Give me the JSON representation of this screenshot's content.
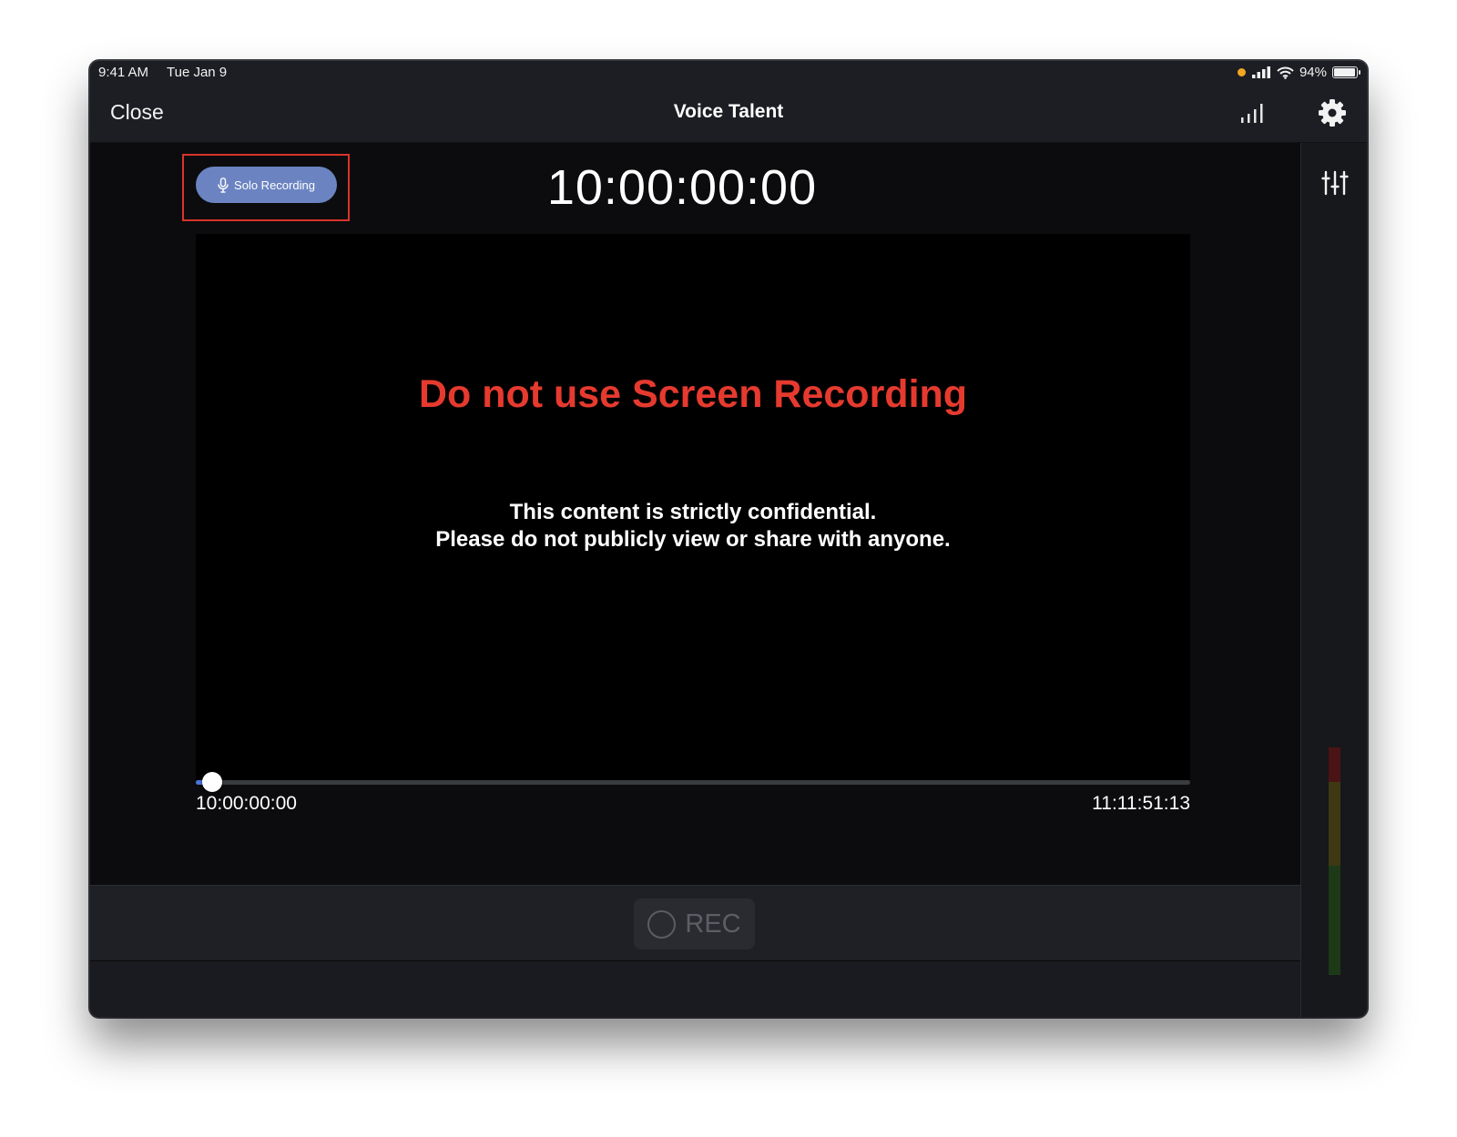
{
  "status_bar": {
    "time": "9:41 AM",
    "date": "Tue Jan 9",
    "battery": "94%",
    "battery_level": 0.94,
    "mic_indicator_color": "#f5a623"
  },
  "nav": {
    "close_label": "Close",
    "title": "Voice Talent",
    "signal_icon": "signal-bars-icon",
    "settings_icon": "gear-icon"
  },
  "main": {
    "solo_button_label": "Solo Recording",
    "solo_button_icon": "microphone-icon",
    "timecode": "10:00:00:00",
    "video": {
      "warning_title": "Do not use Screen Recording",
      "warning_line1": "This content is strictly confidential.",
      "warning_line2": "Please do not publicly view or share with anyone."
    },
    "scrubber": {
      "start_time": "10:00:00:00",
      "end_time": "11:11:51:13",
      "progress": 0.0
    }
  },
  "side_panel": {
    "mixer_icon": "sliders-icon",
    "level_meter": {
      "red": "#4a1416",
      "yellow": "#3f3813",
      "green": "#1c3a18"
    }
  },
  "controls": {
    "rec_label": "REC"
  },
  "colors": {
    "accent_blue": "#6b84c1",
    "warning_red": "#e63a2f",
    "highlight_red": "#d9342b"
  }
}
